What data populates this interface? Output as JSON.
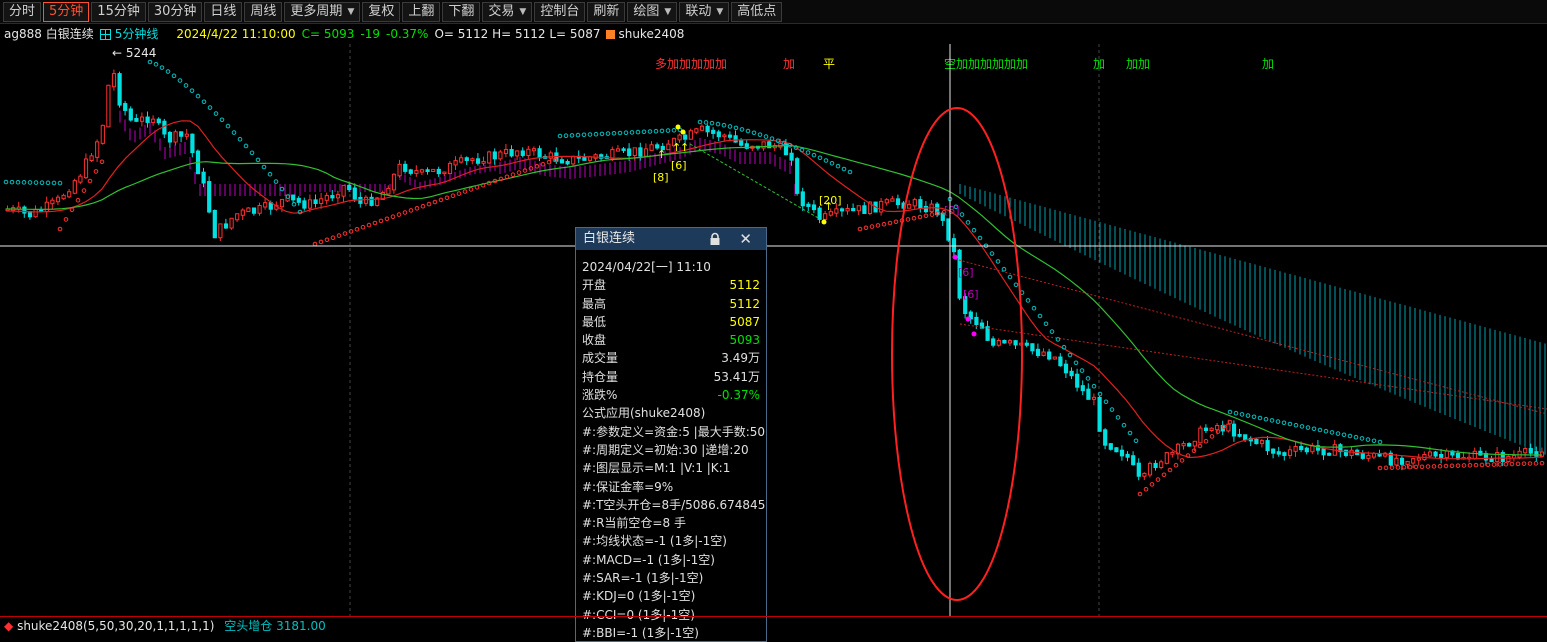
{
  "toolbar": {
    "items": [
      {
        "label": "分时",
        "active": false,
        "dropdown": false
      },
      {
        "label": "5分钟",
        "active": true,
        "dropdown": false
      },
      {
        "label": "15分钟",
        "active": false,
        "dropdown": false
      },
      {
        "label": "30分钟",
        "active": false,
        "dropdown": false
      },
      {
        "label": "日线",
        "active": false,
        "dropdown": false
      },
      {
        "label": "周线",
        "active": false,
        "dropdown": false
      },
      {
        "label": "更多周期",
        "active": false,
        "dropdown": true
      },
      {
        "label": "复权",
        "active": false,
        "dropdown": false
      },
      {
        "label": "上翻",
        "active": false,
        "dropdown": false
      },
      {
        "label": "下翻",
        "active": false,
        "dropdown": false
      },
      {
        "label": "交易",
        "active": false,
        "dropdown": true
      },
      {
        "label": "控制台",
        "active": false,
        "dropdown": false
      },
      {
        "label": "刷新",
        "active": false,
        "dropdown": false
      },
      {
        "label": "绘图",
        "active": false,
        "dropdown": true
      },
      {
        "label": "联动",
        "active": false,
        "dropdown": true
      },
      {
        "label": "高低点",
        "active": false,
        "dropdown": false
      }
    ]
  },
  "info": {
    "symbol": "ag888 白银连续",
    "period": "5分钟线",
    "datetime": "2024/4/22 11:10:00",
    "close": "C= 5093",
    "change": "-19",
    "pct": "-0.37%",
    "ohl": "O= 5112  H= 5112  L= 5087",
    "indicator": "shuke2408",
    "colors": {
      "white": "#e6e6e6",
      "cyan": "#00e0e0",
      "yellow": "#ffff00",
      "green": "#00e000",
      "orange": "#ff7f27"
    }
  },
  "chart": {
    "max_label": "5244",
    "signals": [
      {
        "text": "多加加加加加",
        "color": "#ff3030"
      },
      {
        "text": "加",
        "color": "#ff3030"
      },
      {
        "text": "平",
        "color": "#ffff00"
      },
      {
        "text": "空加加加加加加",
        "color": "#00e000"
      },
      {
        "text": "加",
        "color": "#00e000"
      },
      {
        "text": "加加",
        "color": "#00e000"
      },
      {
        "text": "加",
        "color": "#00e000"
      }
    ],
    "marks": [
      "[8]",
      "[6]",
      "[20]",
      "[8]",
      "[6]",
      "[6]"
    ],
    "candle_up": "#ff3030",
    "candle_down": "#00e0e0",
    "ma_red": "#e02020",
    "ma_green": "#30c030",
    "sar_color_up": "#ff3030",
    "sar_color_down": "#00c0c0",
    "cloud_color": "#00c0d0",
    "cloud_color_bull": "#c000c0"
  },
  "popup": {
    "title": "白银连续",
    "datetime": "2024/04/22[一] 11:10",
    "rows": [
      {
        "k": "开盘",
        "v": "5112",
        "c": ""
      },
      {
        "k": "最高",
        "v": "5112",
        "c": ""
      },
      {
        "k": "最低",
        "v": "5087",
        "c": ""
      },
      {
        "k": "收盘",
        "v": "5093",
        "c": "g"
      },
      {
        "k": "成交量",
        "v": "3.49万",
        "c": "w"
      },
      {
        "k": "持仓量",
        "v": "53.41万",
        "c": "w"
      },
      {
        "k": "涨跌%",
        "v": "-0.37%",
        "c": "g"
      }
    ],
    "lines": [
      "公式应用(shuke2408)",
      "#:参数定义=资金:5 |最大手数:50",
      "#:周期定义=初始:30 |递增:20",
      "#:图层显示=M:1 |V:1 |K:1",
      "#:保证金率=9%",
      "#:T空头开仓=8手/5086.674845",
      "#:R当前空仓=8 手",
      "#:均线状态=-1 (1多|-1空)",
      "#:MACD=-1  (1多|-1空)",
      "#:SAR=-1  (1多|-1空)",
      "#:KDJ=0 (1多|-1空)",
      "#:CCI=0 (1多|-1空)",
      "#:BBI=-1 (1多|-1空)"
    ]
  },
  "bottom": {
    "formula": "shuke2408(5,50,30,20,1,1,1,1,1)",
    "status": "空头增仓 3181.00"
  }
}
